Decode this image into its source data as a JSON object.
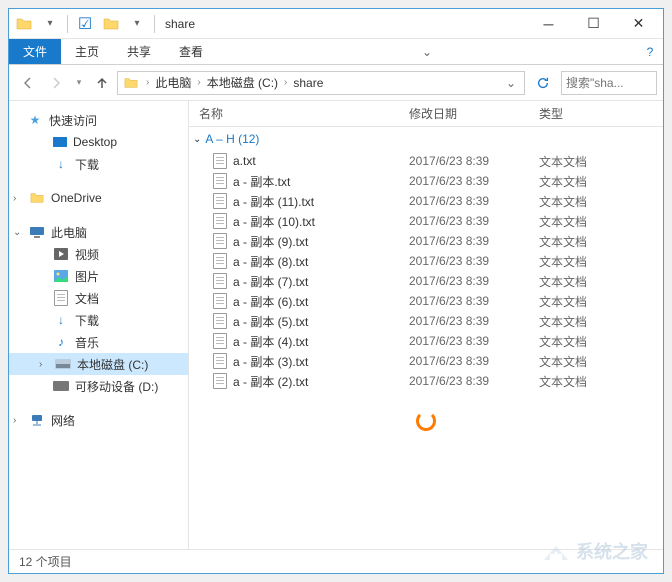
{
  "title": "share",
  "ribbon": {
    "file": "文件",
    "home": "主页",
    "share": "共享",
    "view": "查看"
  },
  "breadcrumb": {
    "pc": "此电脑",
    "drive": "本地磁盘 (C:)",
    "folder": "share"
  },
  "search": {
    "placeholder": "搜索\"sha..."
  },
  "sidebar": {
    "quick": "快速访问",
    "desktop": "Desktop",
    "downloads": "下载",
    "onedrive": "OneDrive",
    "thispc": "此电脑",
    "videos": "视频",
    "pictures": "图片",
    "documents": "文档",
    "downloads2": "下载",
    "music": "音乐",
    "localdisk": "本地磁盘 (C:)",
    "removable": "可移动设备 (D:)",
    "network": "网络"
  },
  "columns": {
    "name": "名称",
    "date": "修改日期",
    "type": "类型"
  },
  "group": {
    "label": "A – H (12)"
  },
  "files": [
    {
      "name": "a.txt",
      "date": "2017/6/23 8:39",
      "type": "文本文档"
    },
    {
      "name": "a - 副本.txt",
      "date": "2017/6/23 8:39",
      "type": "文本文档"
    },
    {
      "name": "a - 副本 (11).txt",
      "date": "2017/6/23 8:39",
      "type": "文本文档"
    },
    {
      "name": "a - 副本 (10).txt",
      "date": "2017/6/23 8:39",
      "type": "文本文档"
    },
    {
      "name": "a - 副本 (9).txt",
      "date": "2017/6/23 8:39",
      "type": "文本文档"
    },
    {
      "name": "a - 副本 (8).txt",
      "date": "2017/6/23 8:39",
      "type": "文本文档"
    },
    {
      "name": "a - 副本 (7).txt",
      "date": "2017/6/23 8:39",
      "type": "文本文档"
    },
    {
      "name": "a - 副本 (6).txt",
      "date": "2017/6/23 8:39",
      "type": "文本文档"
    },
    {
      "name": "a - 副本 (5).txt",
      "date": "2017/6/23 8:39",
      "type": "文本文档"
    },
    {
      "name": "a - 副本 (4).txt",
      "date": "2017/6/23 8:39",
      "type": "文本文档"
    },
    {
      "name": "a - 副本 (3).txt",
      "date": "2017/6/23 8:39",
      "type": "文本文档"
    },
    {
      "name": "a - 副本 (2).txt",
      "date": "2017/6/23 8:39",
      "type": "文本文档"
    }
  ],
  "status": "12 个项目",
  "watermark": "系统之家"
}
